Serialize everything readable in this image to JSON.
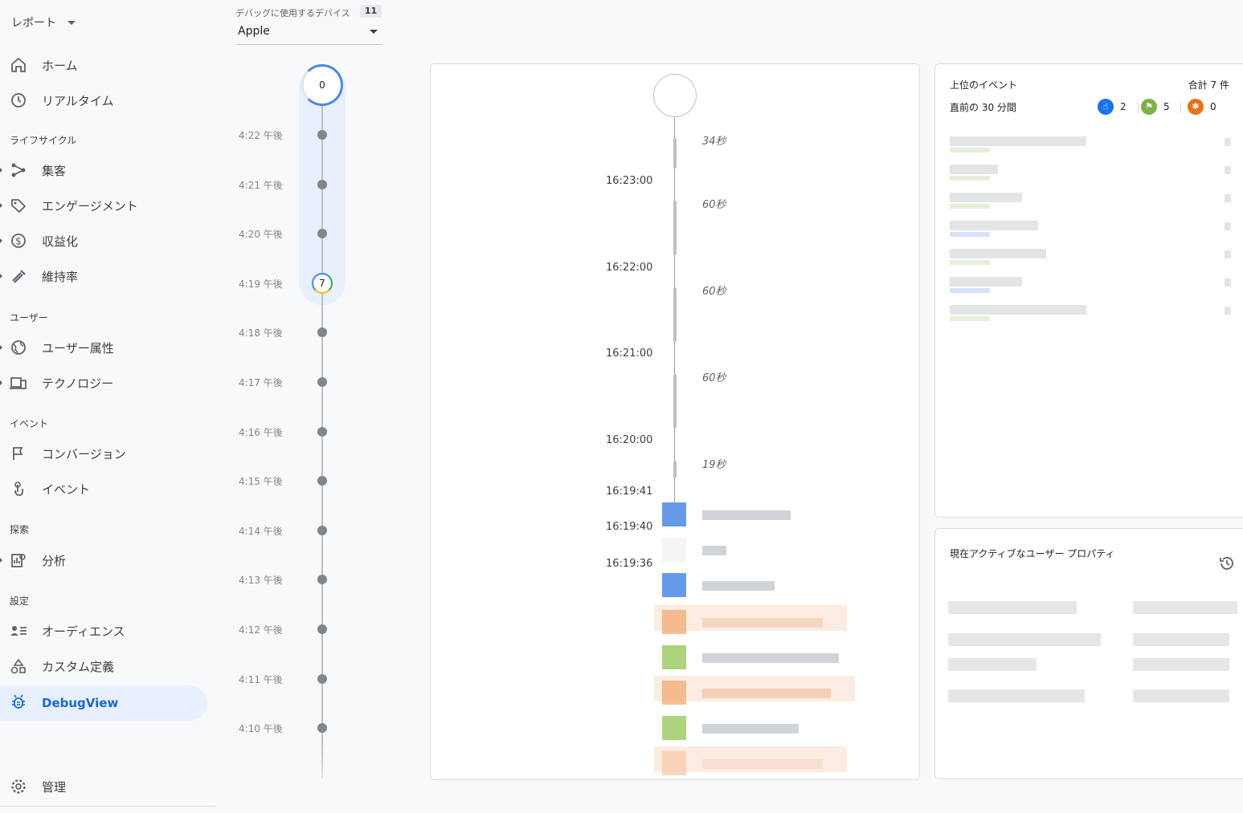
{
  "sidebar": {
    "report_label": "レポート",
    "sections": {
      "lifecycle": "ライフサイクル",
      "user": "ユーザー",
      "event": "イベント",
      "explore": "探索",
      "settings": "設定"
    },
    "items": {
      "home": "ホーム",
      "realtime": "リアルタイム",
      "acquisition": "集客",
      "engagement": "エンゲージメント",
      "monetization": "収益化",
      "retention": "維持率",
      "demographics": "ユーザー属性",
      "technology": "テクノロジー",
      "conversions": "コンバージョン",
      "events": "イベント",
      "analysis": "分析",
      "audiences": "オーディエンス",
      "custom_definitions": "カスタム定義",
      "debugview": "DebugView",
      "admin": "管理"
    }
  },
  "device": {
    "label": "デバッグに使用するデバイス",
    "count": "11",
    "selected": "Apple"
  },
  "minutes": {
    "top_count": "0",
    "rows": [
      {
        "time": "4:22 午後",
        "badge": ""
      },
      {
        "time": "4:21 午後",
        "badge": ""
      },
      {
        "time": "4:20 午後",
        "badge": ""
      },
      {
        "time": "4:19 午後",
        "badge": "7"
      },
      {
        "time": "4:18 午後",
        "badge": ""
      },
      {
        "time": "4:17 午後",
        "badge": ""
      },
      {
        "time": "4:16 午後",
        "badge": ""
      },
      {
        "time": "4:15 午後",
        "badge": ""
      },
      {
        "time": "4:14 午後",
        "badge": ""
      },
      {
        "time": "4:13 午後",
        "badge": ""
      },
      {
        "time": "4:12 午後",
        "badge": ""
      },
      {
        "time": "4:11 午後",
        "badge": ""
      },
      {
        "time": "4:10 午後",
        "badge": ""
      }
    ]
  },
  "stream": {
    "durations": [
      "34秒",
      "60秒",
      "60秒",
      "60秒",
      "19秒"
    ],
    "times": [
      "16:23:00",
      "16:22:00",
      "16:21:00",
      "16:20:00",
      "16:19:41",
      "16:19:40",
      "16:19:36"
    ]
  },
  "top_events": {
    "title": "上位のイベント",
    "total": "合計 7 件",
    "period": "直前の 30 分間",
    "counts": {
      "events": "2",
      "conversions": "5",
      "errors": "0"
    },
    "colors": {
      "events": "#1a73e8",
      "conversions": "#7cb342",
      "errors": "#e8711a"
    }
  },
  "user_props": {
    "title": "現在アクティブなユーザー プロパティ"
  }
}
